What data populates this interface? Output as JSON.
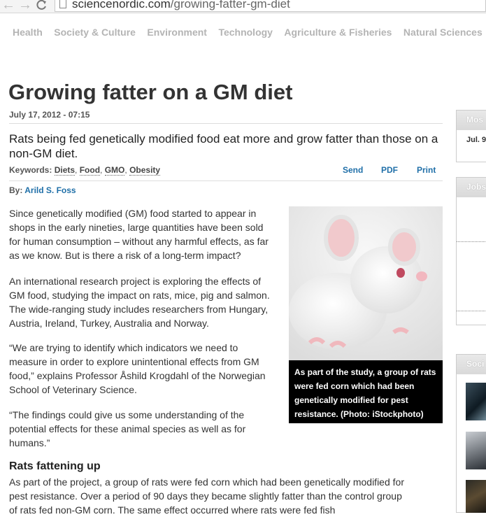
{
  "browser": {
    "url_domain": "sciencenordic.com",
    "url_path": "/growing-fatter-gm-diet"
  },
  "site_nav": [
    "Health",
    "Society & Culture",
    "Environment",
    "Technology",
    "Agriculture & Fisheries",
    "Natural Sciences"
  ],
  "article": {
    "title": "Growing fatter on a GM diet",
    "date": "July 17, 2012 - 07:15",
    "lead": "Rats being fed genetically modified food eat more and grow fatter than those on a non-GM diet.",
    "keywords_label": "Keywords:",
    "keywords": [
      "Diets",
      "Food",
      "GMO",
      "Obesity"
    ],
    "tools": {
      "send": "Send",
      "pdf": "PDF",
      "print": "Print"
    },
    "byline_label": "By:",
    "author": "Arild S. Foss",
    "paragraphs": [
      "Since genetically modified (GM) food started to appear in shops in the early nineties, large quantities have been sold for human consumption – without any harmful effects, as far as we know. But is there a risk of a long-term impact?",
      "An international research project is exploring the effects of GM food, studying the impact on rats, mice, pig and salmon. The wide-ranging study includes researchers from Hungary, Austria, Ireland, Turkey, Australia and Norway.",
      "“We are trying to identify which indicators we need to measure in order to explore unintentional effects from GM food,” explains Professor Åshild Krogdahl of the Norwegian School of Veterinary Science.",
      "“The findings could give us some understanding of the potential effects for these animal species as well as for humans.”"
    ],
    "subhead": "Rats fattening up",
    "body_after_subhead": "As part of the project, a group of rats were fed corn which had been genetically modified for pest resistance. Over a period of 90 days they became slightly fatter than the control group of rats fed non-GM corn. The same effect occurred where rats were fed fish",
    "photo_caption": "As part of the study, a group of rats were fed corn which had been genetically modified for pest resistance. (Photo: iStockphoto)"
  },
  "right_column": {
    "box1_title": "Mos",
    "box1_text": "Jul. 9",
    "box2_title": "Jobs",
    "box3_title": "Soci"
  },
  "icons": [
    "back-arrow-icon",
    "forward-arrow-icon",
    "reload-icon",
    "page-icon"
  ]
}
